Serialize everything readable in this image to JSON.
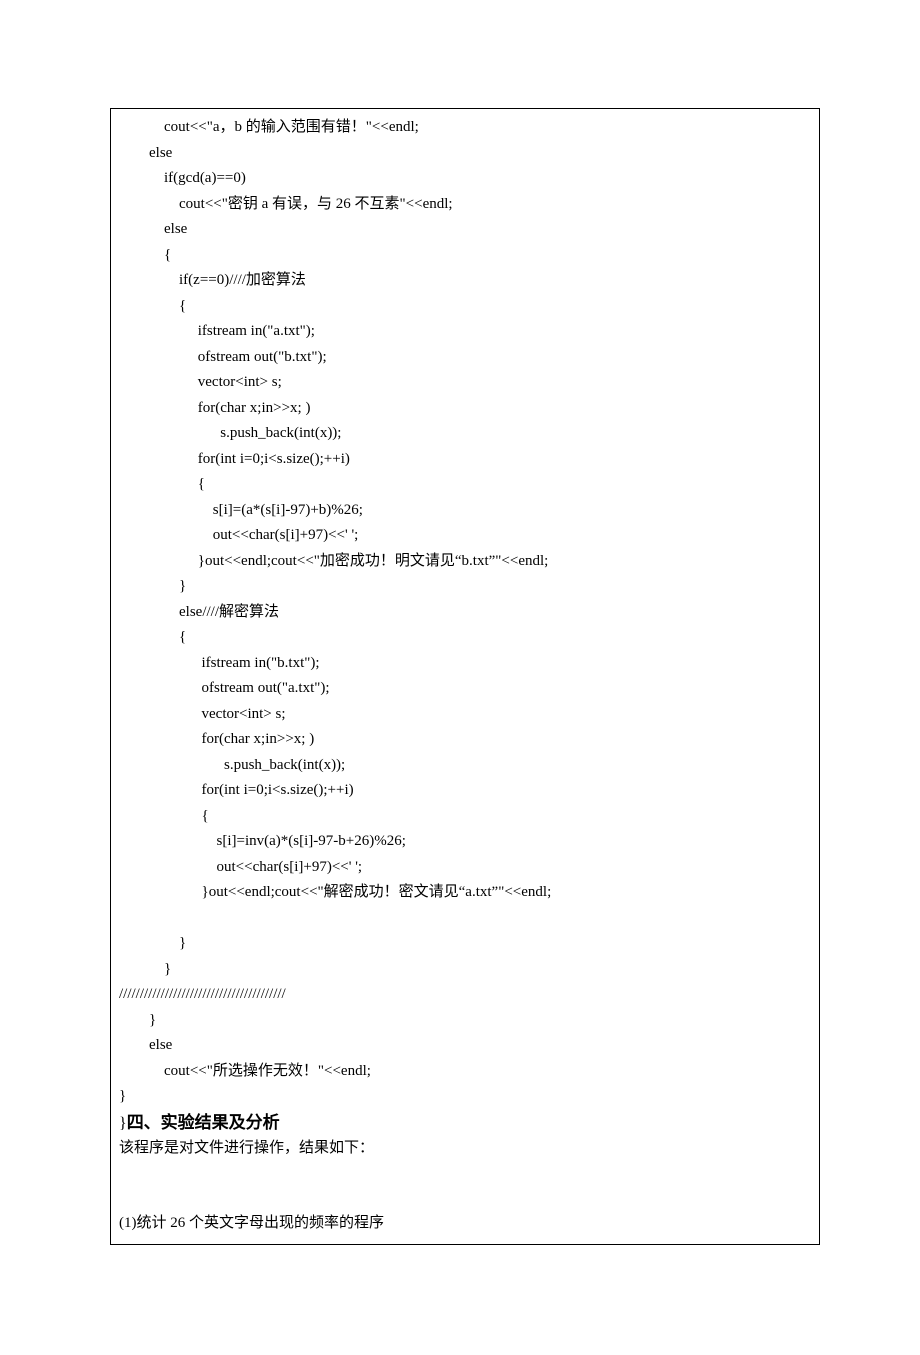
{
  "code": "            cout<<\"a，b 的输入范围有错！\"<<endl;\n        else\n            if(gcd(a)==0)\n                cout<<\"密钥 a 有误，与 26 不互素\"<<endl;\n            else\n            {\n                if(z==0)////加密算法\n                {\n                     ifstream in(\"a.txt\");\n                     ofstream out(\"b.txt\");\n                     vector<int> s;\n                     for(char x;in>>x; )\n                           s.push_back(int(x));\n                     for(int i=0;i<s.size();++i)\n                     {\n                         s[i]=(a*(s[i]-97)+b)%26;\n                         out<<char(s[i]+97)<<' ';\n                     }out<<endl;cout<<\"加密成功！明文请见“b.txt”\"<<endl;\n                }\n                else////解密算法\n                {\n                      ifstream in(\"b.txt\");\n                      ofstream out(\"a.txt\");\n                      vector<int> s;\n                      for(char x;in>>x; )\n                            s.push_back(int(x));\n                      for(int i=0;i<s.size();++i)\n                      {\n                          s[i]=inv(a)*(s[i]-97-b+26)%26;\n                          out<<char(s[i]+97)<<' ';\n                      }out<<endl;cout<<\"解密成功！密文请见“a.txt”\"<<endl;\n\n                }\n            }\n////////////////////////////////////////\n        }\n        else\n            cout<<\"所选操作无效！\"<<endl;\n}",
  "heading_prefix": "}",
  "heading": "四、实验结果及分析",
  "body": "该程序是对文件进行操作，结果如下：",
  "footer": "(1)统计 26 个英文字母出现的频率的程序"
}
